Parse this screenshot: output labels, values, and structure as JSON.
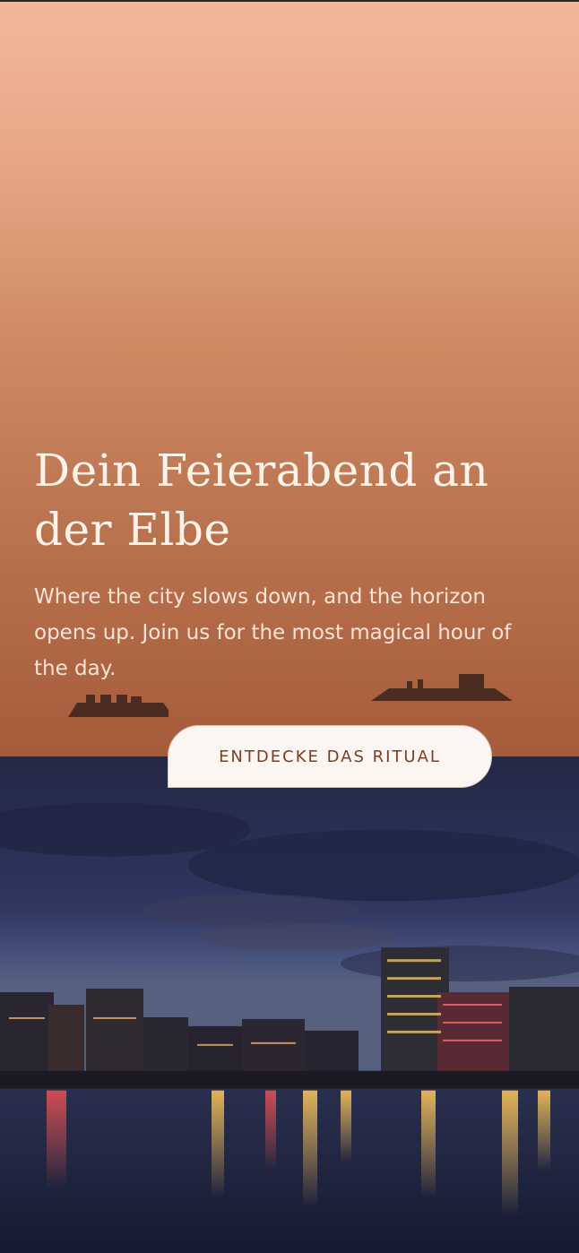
{
  "hero": {
    "title": "Dein Feierabend an der Elbe",
    "subtitle": "Where the city slows down, and the horizon opens up. Join us for the most magical hour of the day.",
    "cta_label": "ENTDECKE DAS RITUAL"
  },
  "icons": {
    "left_ship": "ship-silhouette-icon",
    "right_ship": "ship-silhouette-icon"
  },
  "colors": {
    "hero_top": "#f2b89c",
    "hero_bottom": "#a65b3a",
    "title_text": "#fdf3ea",
    "cta_background": "#fbf6f2",
    "cta_text": "#7d3d22",
    "ship_silhouette": "#4a2c22"
  }
}
